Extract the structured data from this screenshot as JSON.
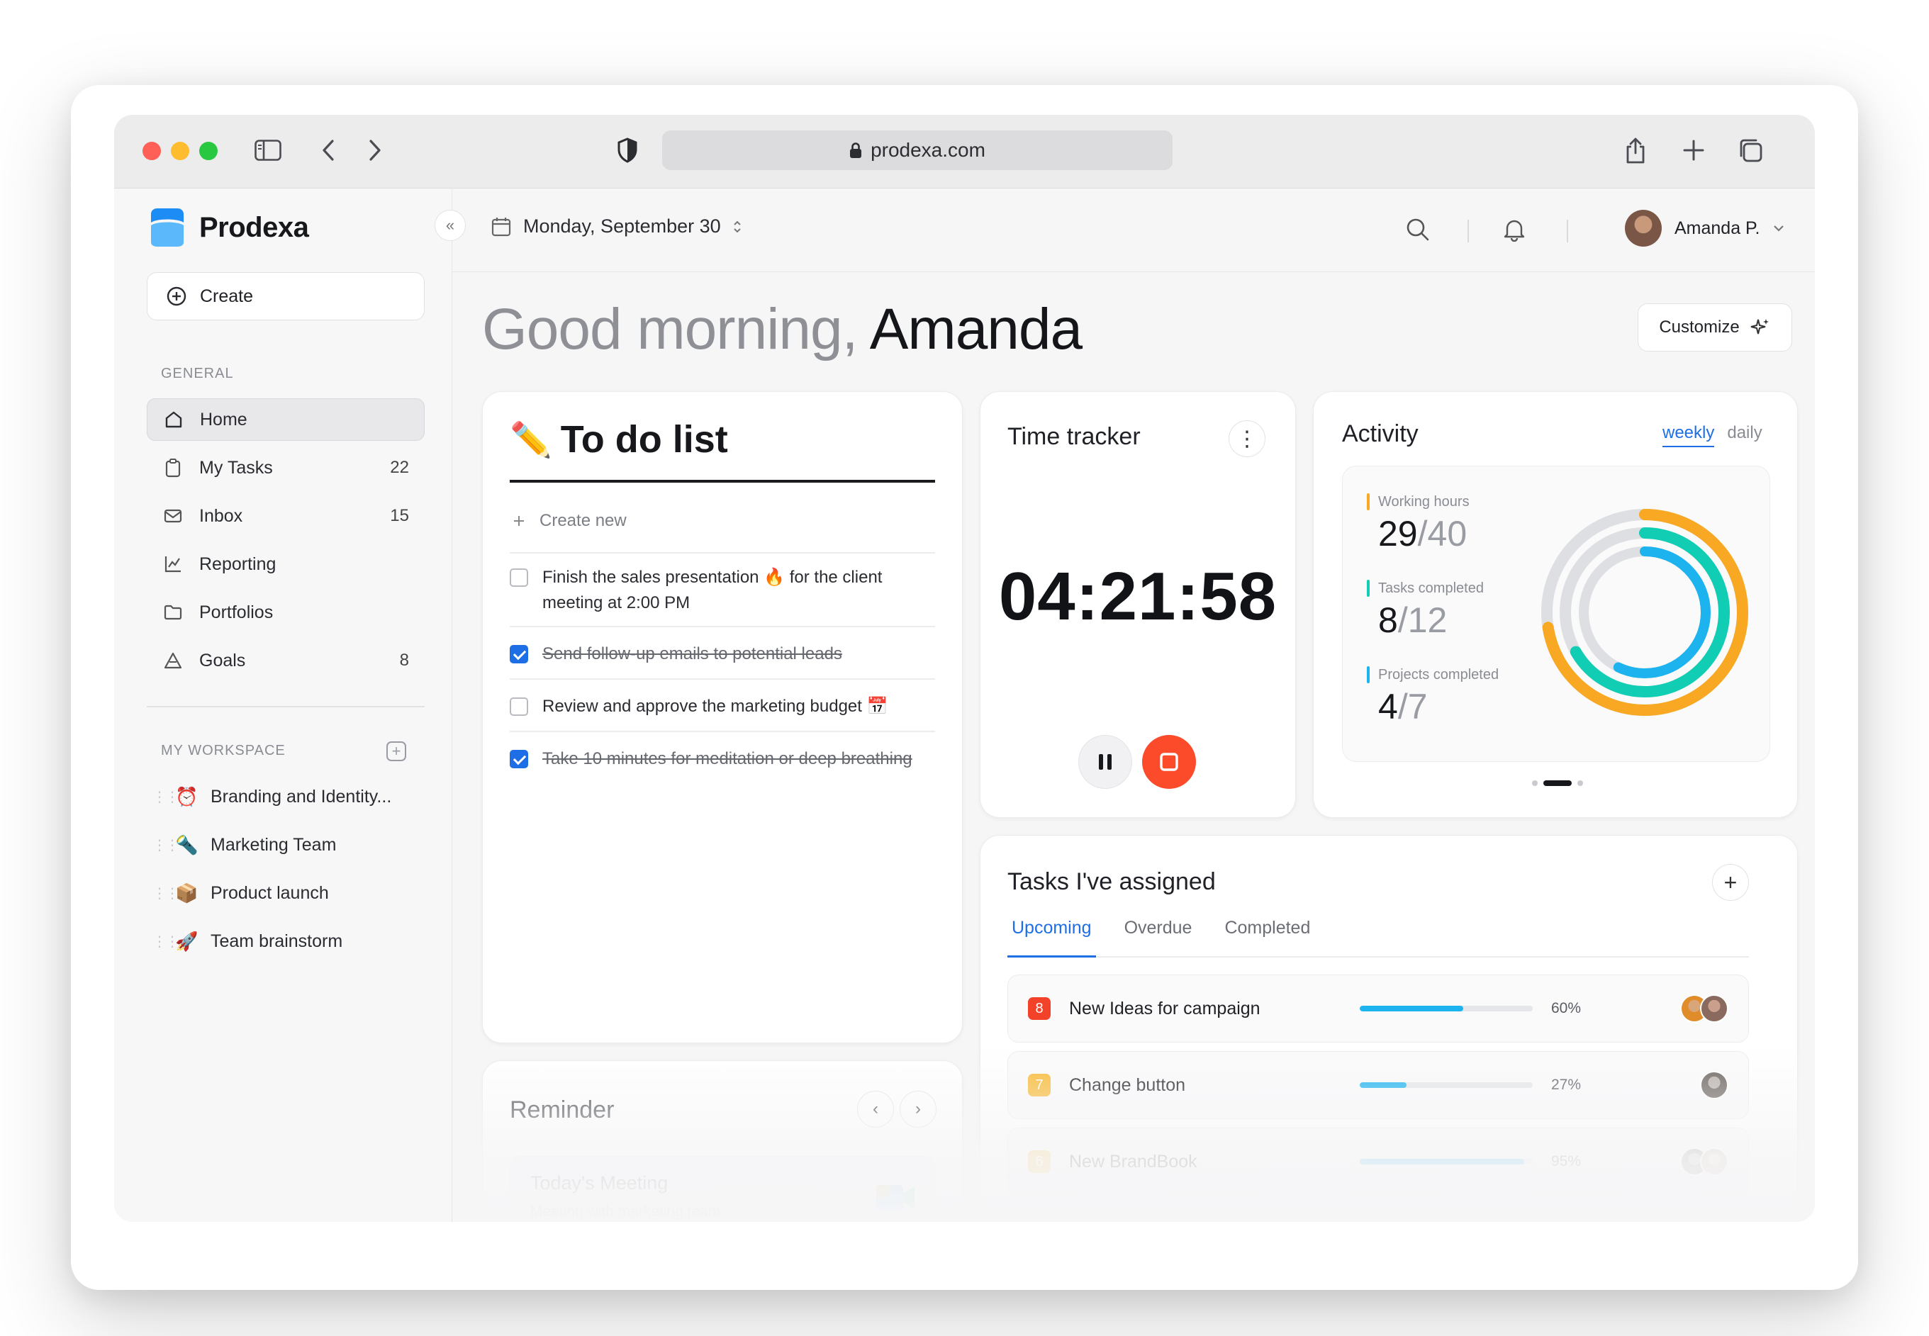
{
  "browser": {
    "url": "prodexa.com"
  },
  "sidebar": {
    "brand": "Prodexa",
    "create_label": "Create",
    "general_label": "GENERAL",
    "nav": [
      {
        "label": "Home",
        "count": ""
      },
      {
        "label": "My Tasks",
        "count": "22"
      },
      {
        "label": "Inbox",
        "count": "15"
      },
      {
        "label": "Reporting",
        "count": ""
      },
      {
        "label": "Portfolios",
        "count": ""
      },
      {
        "label": "Goals",
        "count": "8"
      }
    ],
    "workspace_label": "MY WORKSPACE",
    "workspace": [
      {
        "emoji": "⏰",
        "label": "Branding and Identity..."
      },
      {
        "emoji": "🔦",
        "label": "Marketing Team"
      },
      {
        "emoji": "📦",
        "label": "Product launch"
      },
      {
        "emoji": "🚀",
        "label": "Team brainstorm"
      }
    ]
  },
  "topbar": {
    "date": "Monday, September 30",
    "user_name": "Amanda P."
  },
  "greeting": {
    "prefix": "Good morning,",
    "name": "Amanda",
    "customize_label": "Customize"
  },
  "todo": {
    "emoji": "✏️",
    "title": "To do list",
    "create_new": "Create new",
    "items": [
      {
        "text": "Finish the sales presentation 🔥 for the client meeting at 2:00 PM",
        "done": false
      },
      {
        "text": "Send follow-up emails to potential leads",
        "done": true
      },
      {
        "text": "Review and approve the marketing budget 📅",
        "done": false
      },
      {
        "text": "Take 10 minutes for meditation or deep breathing",
        "done": true
      }
    ]
  },
  "timer": {
    "title": "Time tracker",
    "time": "04:21:58"
  },
  "activity": {
    "title": "Activity",
    "tab_weekly": "weekly",
    "tab_daily": "daily",
    "metrics": [
      {
        "label": "Working hours",
        "value": "29",
        "total": "/40",
        "color": "#f8a823"
      },
      {
        "label": "Tasks completed",
        "value": "8",
        "total": "/12",
        "color": "#10cdb3"
      },
      {
        "label": "Projects completed",
        "value": "4",
        "total": "/7",
        "color": "#1cb3ef"
      }
    ],
    "rings": [
      {
        "fraction": 0.725,
        "color": "#f8a823"
      },
      {
        "fraction": 0.667,
        "color": "#10cdb3"
      },
      {
        "fraction": 0.571,
        "color": "#1cb3ef"
      }
    ]
  },
  "tasks": {
    "title": "Tasks I've assigned",
    "tabs": [
      "Upcoming",
      "Overdue",
      "Completed"
    ],
    "rows": [
      {
        "badge": "8",
        "badge_color": "#f2432a",
        "name": "New Ideas for campaign",
        "progress": 0.6,
        "pct": "60%"
      },
      {
        "badge": "7",
        "badge_color": "#f8b932",
        "name": "Change button",
        "progress": 0.27,
        "pct": "27%"
      },
      {
        "badge": "6",
        "badge_color": "#f8b932",
        "name": "New BrandBook",
        "progress": 0.95,
        "pct": "95%"
      }
    ]
  },
  "reminder": {
    "title": "Reminder",
    "meeting": "Today's Meeting",
    "meeting_sub": "Meeting with marketing team"
  }
}
